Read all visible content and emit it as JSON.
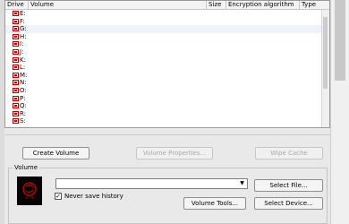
{
  "columns": [
    "Drive",
    "Volume",
    "Size",
    "Encryption algorithm",
    "Type"
  ],
  "drives": [
    "E:",
    "F:",
    "G:",
    "H:",
    "I:",
    "J:",
    "K:",
    "L:",
    "M:",
    "N:",
    "O:",
    "P:",
    "Q:",
    "R:",
    "S:"
  ],
  "buttons": {
    "create_volume": "Create Volume",
    "volume_properties": "Volume Properties...",
    "wipe_cache": "Wipe Cache"
  },
  "volume_group": {
    "title": "Volume",
    "path_value": "",
    "never_save_history": "Never save history",
    "never_save_history_checked": true,
    "select_file": "Select File...",
    "volume_tools": "Volume Tools...",
    "select_device": "Select Device..."
  }
}
